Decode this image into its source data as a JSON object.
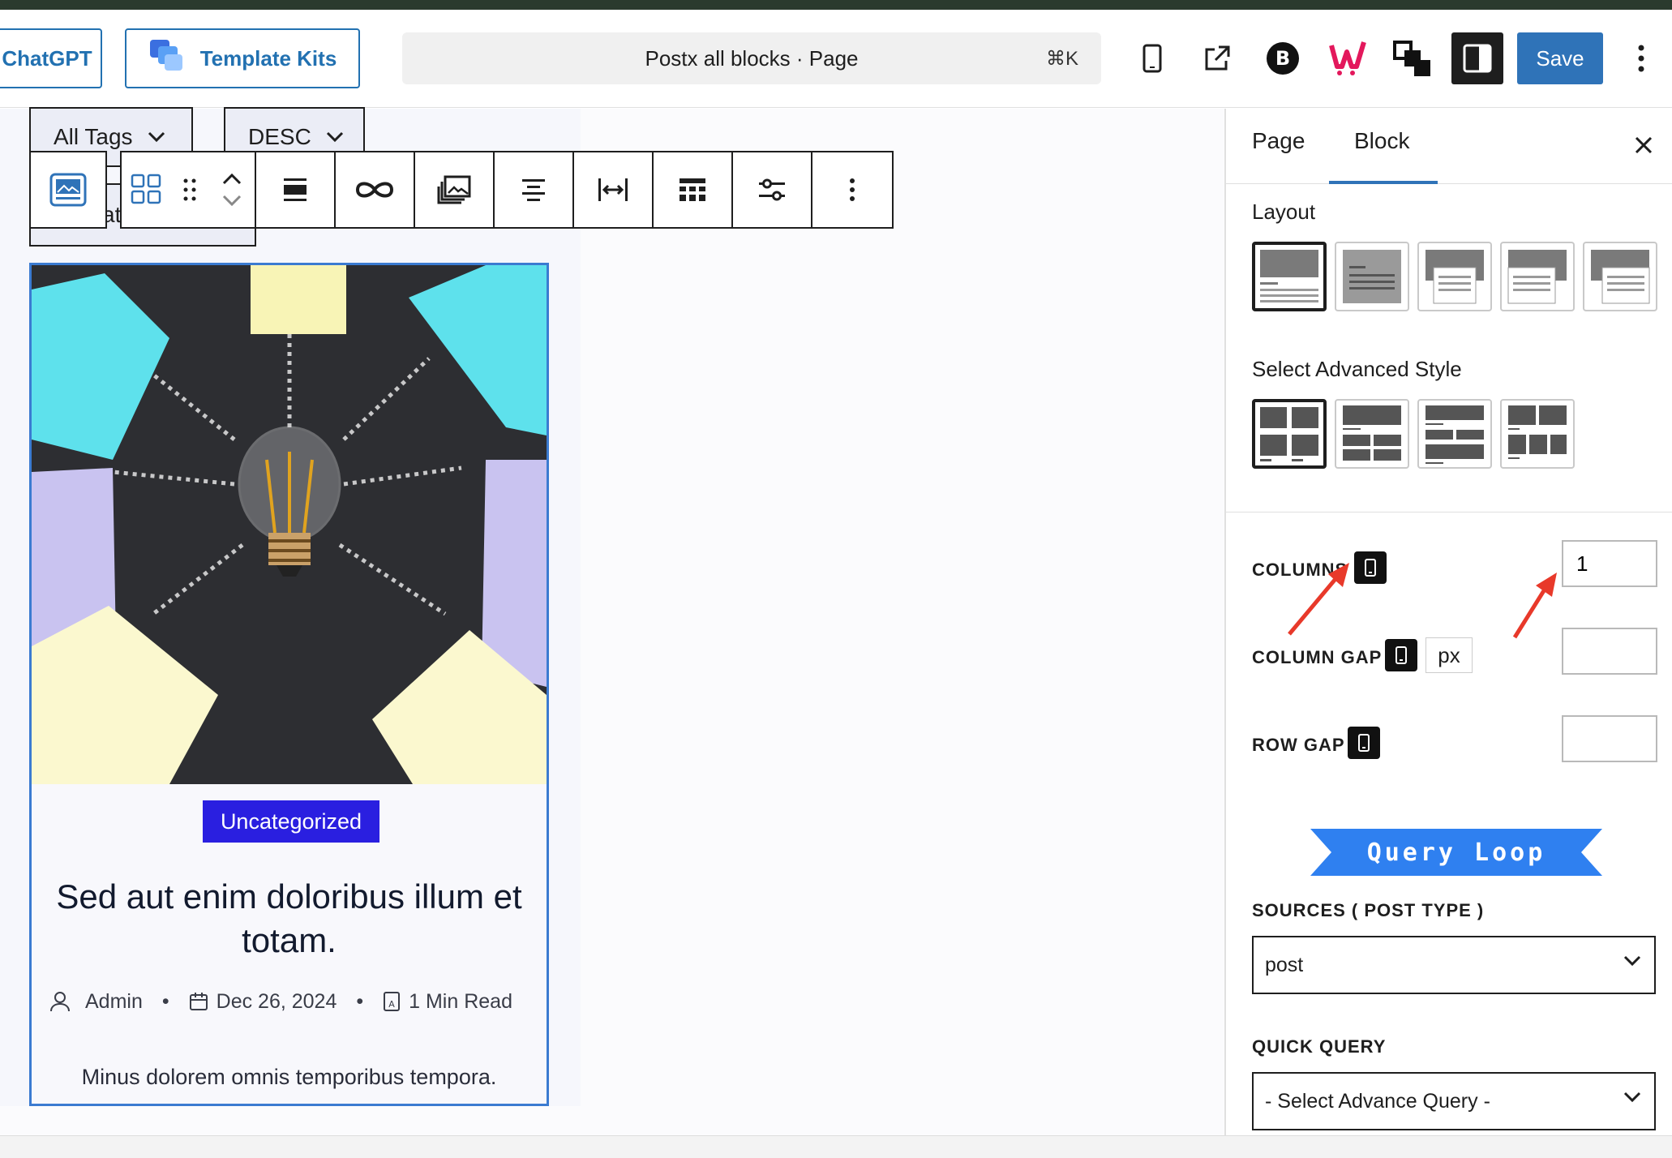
{
  "topbar": {
    "chatgpt_label": "ChatGPT",
    "template_kits_label": "Template Kits",
    "command_title": "Postx all blocks · Page",
    "command_shortcut": "⌘K",
    "save_label": "Save"
  },
  "filters": {
    "tags": "All Tags",
    "order": "DESC",
    "partial_text": "at"
  },
  "post_card": {
    "category": "Uncategorized",
    "title": "Sed aut enim doloribus illum et totam.",
    "author": "Admin",
    "date": "Dec 26, 2024",
    "read_time": "1 Min Read",
    "excerpt": "Minus dolorem omnis temporibus tempora."
  },
  "sidebar": {
    "tab_page": "Page",
    "tab_block": "Block",
    "layout_title": "Layout",
    "advanced_style_title": "Select Advanced Style",
    "columns_label": "COLUMNS",
    "columns_value": "1",
    "column_gap_label": "COLUMN GAP",
    "column_gap_unit": "px",
    "row_gap_label": "ROW GAP",
    "banner_text": "Query Loop",
    "sources_label": "SOURCES ( POST TYPE )",
    "sources_value": "post",
    "quick_query_label": "QUICK QUERY",
    "quick_query_value": "- Select Advance Query -"
  },
  "colors": {
    "accent": "#2f73b8",
    "badge": "#2a1fe0",
    "banner": "#2f80f0",
    "annotation_arrow": "#e8392a"
  }
}
